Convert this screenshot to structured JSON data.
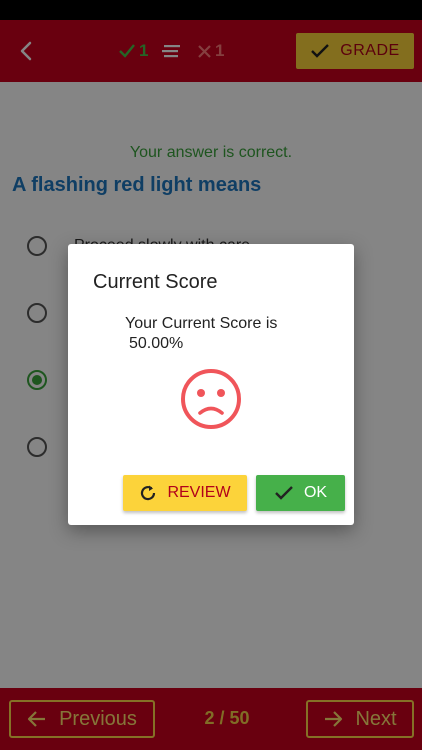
{
  "header": {
    "back_icon": "chevron-left-icon",
    "correct_count": "1",
    "wrong_count": "1",
    "grade_label": "GRADE"
  },
  "question": {
    "feedback": "Your answer is correct.",
    "text": "A flashing red light means",
    "options": [
      {
        "text": "Proceed slowly with care",
        "selected": false
      },
      {
        "text": "",
        "selected": false
      },
      {
        "text": "",
        "selected": true
      },
      {
        "text": "",
        "selected": false
      }
    ]
  },
  "footer": {
    "previous_label": "Previous",
    "page": "2 / 50",
    "next_label": "Next"
  },
  "dialog": {
    "title": "Current Score",
    "message": "Your Current Score is",
    "score": "50.00%",
    "face_icon": "sad-face-icon",
    "review_label": "REVIEW",
    "ok_label": "OK"
  },
  "colors": {
    "primary_red": "#c9001d",
    "accent_yellow": "#fcd33a",
    "success_green": "#46b04a",
    "question_blue": "#1d77c0",
    "sad_face_red": "#f0555a"
  }
}
